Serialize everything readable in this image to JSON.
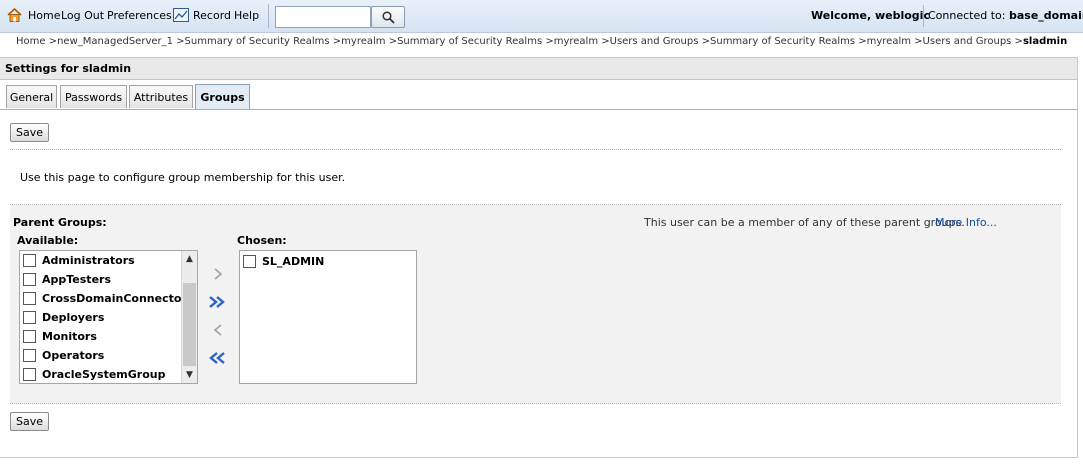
{
  "topbar": {
    "home": "Home",
    "logout": "Log Out",
    "preferences": "Preferences",
    "record": "Record",
    "help": "Help",
    "search_value": "",
    "welcome": "Welcome, weblogic",
    "connected_label": "Connected to:",
    "domain": "base_domain"
  },
  "breadcrumb": {
    "path": "Home >new_ManagedServer_1 >Summary of Security Realms >myrealm >Summary of Security Realms >myrealm >Users and Groups >Summary of Security Realms >myrealm >Users and Groups >",
    "current": "sladmin"
  },
  "panel": {
    "title": "Settings for sladmin",
    "tabs": [
      "General",
      "Passwords",
      "Attributes",
      "Groups"
    ],
    "save_label": "Save",
    "description": "Use this page to configure group membership for this user.",
    "parent_groups_label": "Parent Groups:",
    "available_label": "Available:",
    "chosen_label": "Chosen:",
    "hint": "This user can be a member of any of these parent groups.",
    "more_info": "More Info...",
    "available": [
      "Administrators",
      "AppTesters",
      "CrossDomainConnectors",
      "Deployers",
      "Monitors",
      "Operators",
      "OracleSystemGroup"
    ],
    "chosen": [
      "SL_ADMIN"
    ]
  },
  "colors": {
    "accent": "#1a4a9b",
    "topbar": "#d5e3f2",
    "active_tab": "#e3ecf5"
  }
}
